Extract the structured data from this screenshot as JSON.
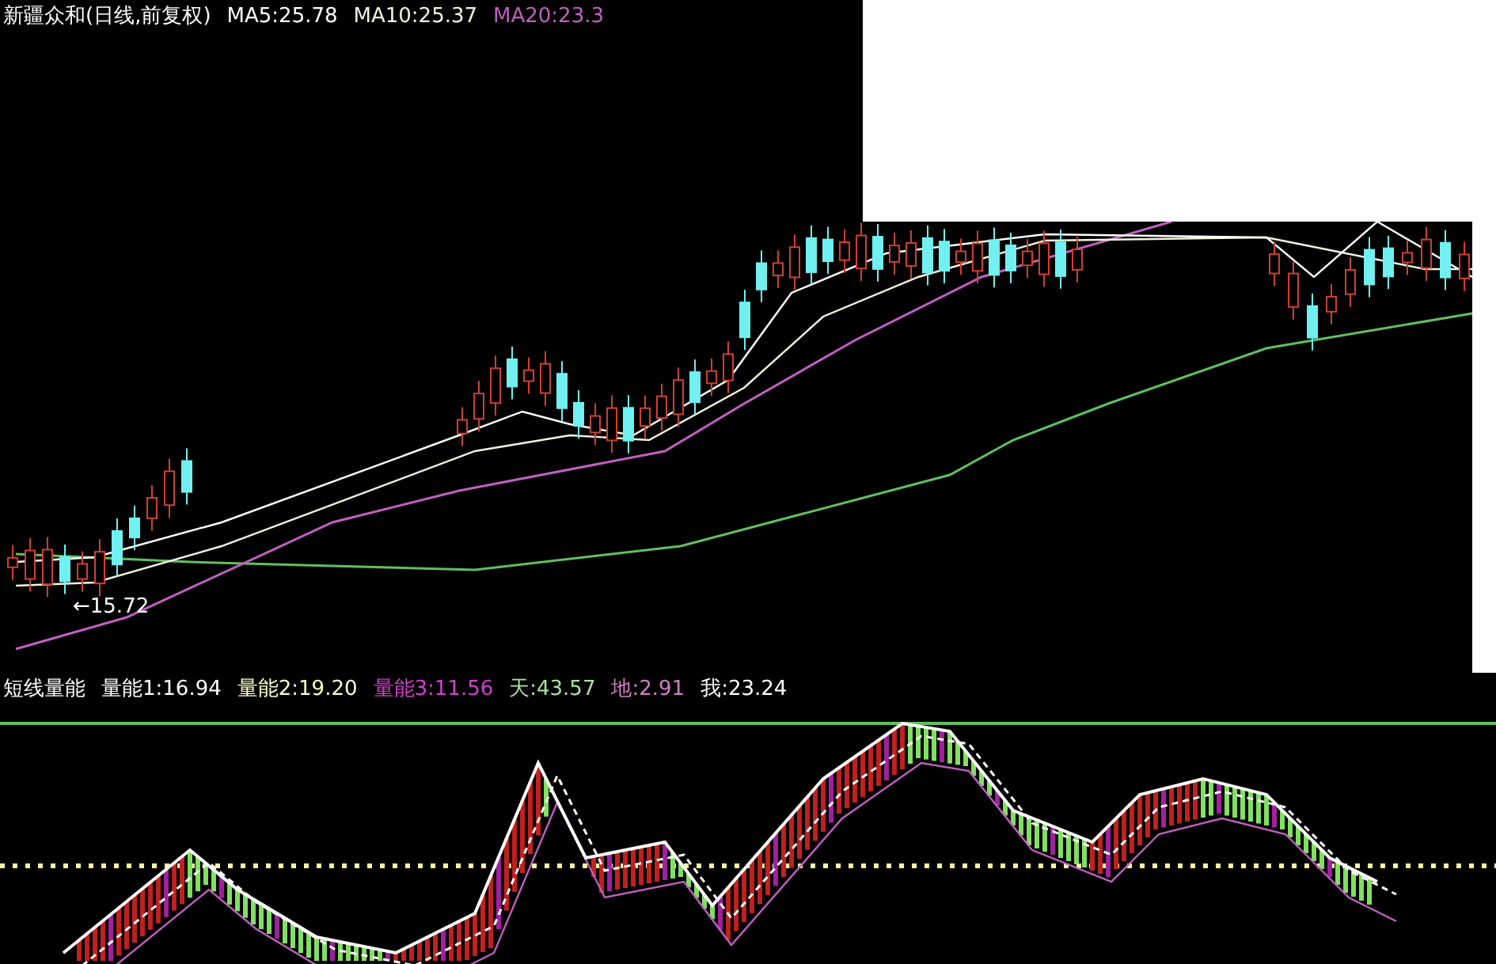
{
  "main_chart": {
    "title": "新疆众和(日线,前复权)",
    "indicators": [
      {
        "label": "MA5:25.78",
        "color": "#ffffff"
      },
      {
        "label": "MA10:25.37",
        "color": "#f4f4dc"
      },
      {
        "label": "MA20:23.3",
        "color": "#c060c0"
      }
    ],
    "low_label": "←15.72"
  },
  "sub_chart": {
    "title": "短线量能",
    "indicators": [
      {
        "label": "量能1:16.94",
        "color": "#ffffff"
      },
      {
        "label": "量能2:19.20",
        "color": "#ffffcc"
      },
      {
        "label": "量能3:11.56",
        "color": "#d040d0"
      },
      {
        "label": "天:43.57",
        "color": "#a8e0a0"
      },
      {
        "label": "地:2.91",
        "color": "#d080c0"
      },
      {
        "label": "我:23.24",
        "color": "#ffffff"
      }
    ]
  }
}
